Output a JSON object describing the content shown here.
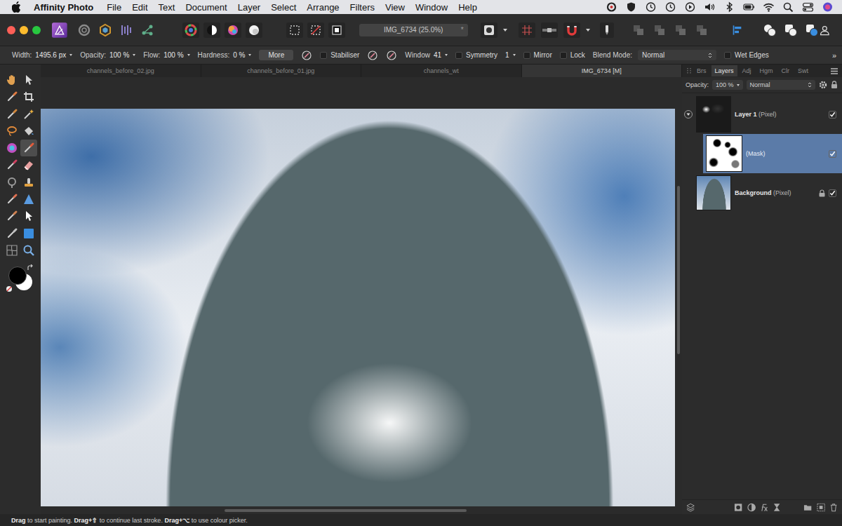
{
  "menu_bar": {
    "app_name": "Affinity Photo",
    "items": [
      "File",
      "Edit",
      "Text",
      "Document",
      "Layer",
      "Select",
      "Arrange",
      "Filters",
      "View",
      "Window",
      "Help"
    ]
  },
  "toolbar": {
    "document": "IMG_6734 (25.0%)",
    "modified_mark": "*"
  },
  "context_toolbar": {
    "items": [
      {
        "kind": "field",
        "label": "Width:",
        "value": "1495.6 px"
      },
      {
        "kind": "field",
        "label": "Opacity:",
        "value": "100 %"
      },
      {
        "kind": "field",
        "label": "Flow:",
        "value": "100 %"
      },
      {
        "kind": "field",
        "label": "Hardness:",
        "value": "0 %"
      },
      {
        "kind": "button",
        "label": "More"
      },
      {
        "kind": "icon-button"
      },
      {
        "kind": "checkbox",
        "label": "Stabiliser",
        "checked": false
      },
      {
        "kind": "icon-button"
      },
      {
        "kind": "icon-button"
      },
      {
        "kind": "field",
        "label": "Window",
        "value": "41"
      },
      {
        "kind": "checkbox",
        "label": "Symmetry",
        "checked": false
      },
      {
        "kind": "field",
        "value": "1"
      },
      {
        "kind": "checkbox",
        "label": "Mirror",
        "checked": false
      },
      {
        "kind": "checkbox",
        "label": "Lock",
        "checked": false
      },
      {
        "kind": "dropdown",
        "label": "Blend Mode:",
        "value": "Normal"
      },
      {
        "kind": "checkbox",
        "label": "Wet Edges",
        "checked": false
      }
    ],
    "overflow": "»"
  },
  "tools": [
    {
      "selected": false
    },
    {
      "selected": false
    },
    {
      "selected": false
    },
    {
      "selected": false
    },
    {
      "selected": false
    },
    {
      "selected": false
    },
    {
      "selected": false
    },
    {
      "selected": false
    },
    {
      "selected": false
    },
    {
      "selected": true
    },
    {
      "selected": false
    },
    {
      "selected": false
    },
    {
      "selected": false
    },
    {
      "selected": false
    },
    {
      "selected": false
    },
    {
      "selected": false
    },
    {
      "selected": false
    },
    {
      "selected": false
    },
    {
      "selected": false
    },
    {
      "selected": false
    },
    {
      "selected": false
    },
    {
      "selected": false
    }
  ],
  "document_tabs": [
    {
      "label": "channels_before_02.jpg",
      "selected": false
    },
    {
      "label": "channels_before_01.jpg",
      "selected": false
    },
    {
      "label": "channels_wt",
      "selected": false
    },
    {
      "label": "IMG_6734 [M]",
      "selected": true
    }
  ],
  "panel_tabs": [
    {
      "label": "Brs",
      "selected": false
    },
    {
      "label": "Layers",
      "selected": true
    },
    {
      "label": "Adj",
      "selected": false
    },
    {
      "label": "Hgm",
      "selected": false
    },
    {
      "label": "Clr",
      "selected": false
    },
    {
      "label": "Swt",
      "selected": false
    }
  ],
  "layers_panel": {
    "opacity_label": "Opacity:",
    "opacity": "100 %",
    "blend_mode": "Normal",
    "layers": [
      {
        "kind": "layer",
        "name": "Layer 1",
        "type": "(Pixel)",
        "visible": true,
        "locked": false,
        "selected": false,
        "expanded": true
      },
      {
        "kind": "mask",
        "type": "(Mask)",
        "visible": true,
        "locked": false,
        "selected": true
      },
      {
        "kind": "background",
        "name": "Background",
        "type": "(Pixel)",
        "visible": true,
        "locked": true,
        "selected": false
      }
    ]
  },
  "status_bar": {
    "segments": [
      {
        "text": "Drag",
        "bold": true
      },
      {
        "text": " to start painting. ",
        "bold": false
      },
      {
        "text": "Drag+⇧",
        "bold": true
      },
      {
        "text": " to continue last stroke. ",
        "bold": false
      },
      {
        "text": "Drag+⌥",
        "bold": true
      },
      {
        "text": " to use colour picker.",
        "bold": false
      }
    ]
  }
}
